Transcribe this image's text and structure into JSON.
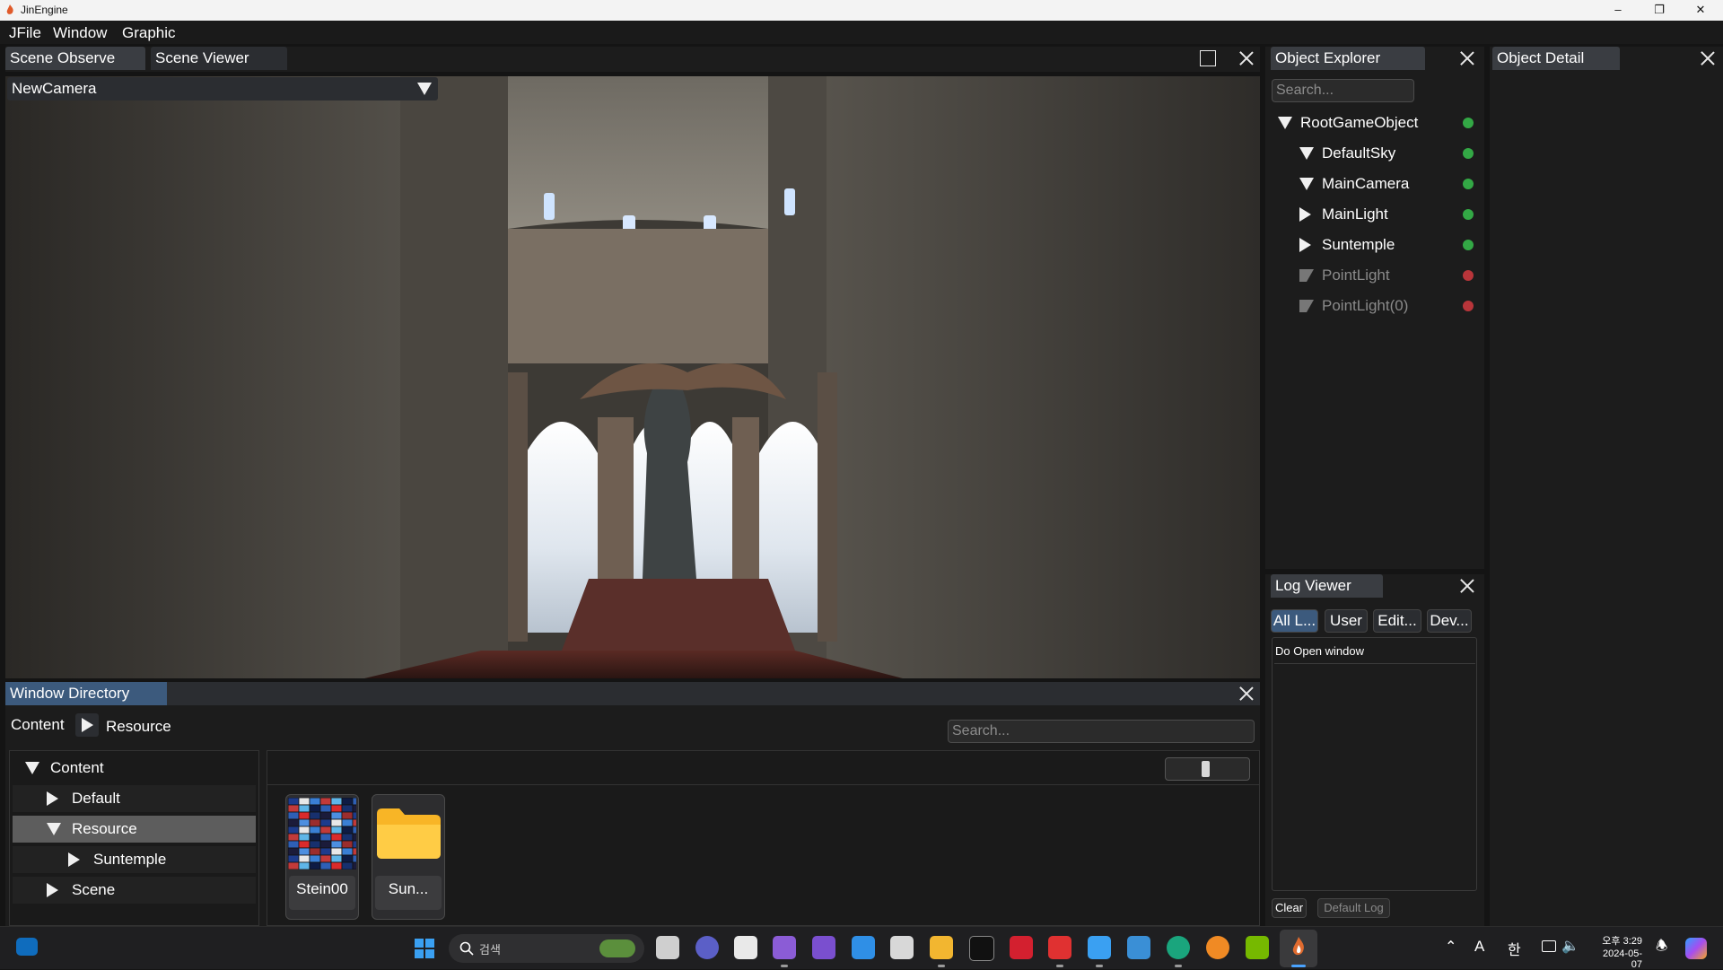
{
  "window": {
    "title": "JinEngine"
  },
  "menubar": {
    "items": [
      "JFile",
      "Window",
      "Graphic"
    ]
  },
  "scene_tabs": [
    "Scene Observe",
    "Scene Viewer"
  ],
  "scene_viewer": {
    "camera_selected": "NewCamera"
  },
  "object_explorer": {
    "title": "Object Explorer",
    "search_placeholder": "Search...",
    "items": [
      {
        "label": "RootGameObject",
        "state": "expanded",
        "status": "active",
        "dim": false
      },
      {
        "label": "DefaultSky",
        "state": "expanded",
        "status": "active",
        "dim": false
      },
      {
        "label": "MainCamera",
        "state": "expanded",
        "status": "active",
        "dim": false
      },
      {
        "label": "MainLight",
        "state": "collapsed",
        "status": "active",
        "dim": false
      },
      {
        "label": "Suntemple",
        "state": "collapsed",
        "status": "active",
        "dim": false
      },
      {
        "label": "PointLight",
        "state": "expanded",
        "status": "inactive",
        "dim": true
      },
      {
        "label": "PointLight(0)",
        "state": "expanded",
        "status": "inactive",
        "dim": true
      }
    ]
  },
  "object_detail": {
    "title": "Object Detail"
  },
  "log_viewer": {
    "title": "Log Viewer",
    "filter_tabs": [
      "All L...",
      "User",
      "Edit...",
      "Dev..."
    ],
    "entries": [
      "Do Open window"
    ],
    "clear_label": "Clear",
    "default_log_label": "Default Log"
  },
  "window_directory": {
    "title": "Window Directory",
    "breadcrumb": [
      "Content",
      "Resource"
    ],
    "search_placeholder": "Search...",
    "tree": [
      {
        "label": "Content",
        "state": "expanded",
        "level": 0,
        "selected": false
      },
      {
        "label": "Default",
        "state": "collapsed",
        "level": 1,
        "selected": false
      },
      {
        "label": "Resource",
        "state": "expanded",
        "level": 1,
        "selected": true
      },
      {
        "label": "Suntemple",
        "state": "collapsed",
        "level": 2,
        "selected": false
      },
      {
        "label": "Scene",
        "state": "collapsed",
        "level": 1,
        "selected": false
      }
    ],
    "assets": [
      {
        "label": "Stein00",
        "icon": "texture-thumbnail-icon"
      },
      {
        "label": "Sun...",
        "icon": "folder-icon"
      }
    ]
  },
  "taskbar": {
    "search_placeholder": "검색",
    "tray": {
      "ime_mode": "A",
      "ime_lang": "한",
      "time": "오후 3:29",
      "date": "2024-05-07"
    }
  },
  "colors": {
    "status_active": "#33a845",
    "status_inactive": "#b8353a",
    "tab_window_directory": "#3c5a7d",
    "selected_row": "#5d5d5d",
    "folder": "#f8b526"
  }
}
